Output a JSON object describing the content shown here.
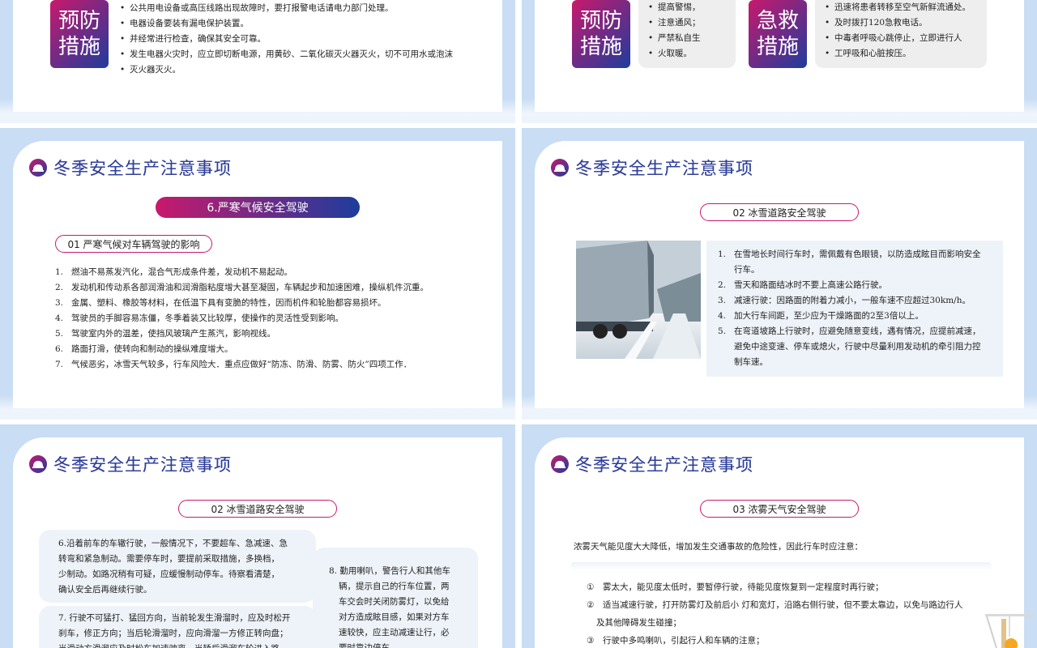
{
  "header_title": "冬季安全生产注意事项",
  "slide_tl": {
    "tag_line1": "预防",
    "tag_line2": "措施",
    "items": [
      "公共用电设备或高压线路出现故障时，要打报警电话请电力部门处理。",
      "电器设备要装有漏电保护装置。",
      "并经常进行检查，确保其安全可靠。",
      "发生电器火灾时，应立即切断电源，用黄砂、二氧化碳灭火器灭火，切不可用水或泡沫",
      "灭火器灭火。"
    ]
  },
  "slide_tr": {
    "tag1_line1": "预防",
    "tag1_line2": "措施",
    "box1": [
      "提高警惕，",
      "注意通风；",
      "严禁私自生",
      "火取暖。"
    ],
    "tag2_line1": "急救",
    "tag2_line2": "措施",
    "box2": [
      "迅速将患者转移至空气新鲜流通处。",
      "及时拨打120急救电话。",
      "中毒者呼吸心跳停止，立即进行人",
      "工呼吸和心脏按压。"
    ]
  },
  "slide_ml": {
    "section_pill": "6.严寒气候安全驾驶",
    "sub_pill": "01 严寒气候对车辆驾驶的影响",
    "items": [
      {
        "n": "1.",
        "t": "燃油不易蒸发汽化，混合气形成条件差，发动机不易起动。"
      },
      {
        "n": "2.",
        "t": "发动机和传动系各部润滑油和润滑脂粘度增大甚至凝固，车辆起步和加速困难，操纵机件沉重。"
      },
      {
        "n": "3.",
        "t": "金属、塑料、橡胶等材料，在低温下具有变脆的特性，因而机件和轮胎都容易损坏。"
      },
      {
        "n": "4.",
        "t": "驾驶员的手脚容易冻僵，冬季着装又比较厚，使操作的灵活性受到影响。"
      },
      {
        "n": "5.",
        "t": "驾驶室内外的温差，使挡风玻璃产生蒸汽，影响视线。"
      },
      {
        "n": "6.",
        "t": "路面打滑，使转向和制动的操纵难度增大。"
      },
      {
        "n": "7.",
        "t": "气候恶劣，冰雪天气较多，行车风险大．重点应做好“防冻、防滑、防雾、防火”四项工作．"
      }
    ]
  },
  "slide_mr": {
    "sub_pill": "02 冰雪道路安全驾驶",
    "items": [
      {
        "n": "1.",
        "t": "在雪地长时间行车时，需佩戴有色眼镜，以防造成眩目而影响安全"
      },
      {
        "n": "",
        "t": "行车。"
      },
      {
        "n": "2.",
        "t": "雪天和路面结冰时不要上高速公路行驶。"
      },
      {
        "n": "3.",
        "t": "减速行驶：因路面的附着力减小，一般车速不应超过30km/h。"
      },
      {
        "n": "4.",
        "t": "加大行车间距，至少应为干燥路面的2至3倍以上。"
      },
      {
        "n": "5.",
        "t": "在弯道坡路上行驶时，应避免随意变线，遇有情况，应提前减速，"
      },
      {
        "n": "",
        "t": "避免中途变速、停车或熄火，行驶中尽量利用发动机的牵引阻力控"
      },
      {
        "n": "",
        "t": "制车速。"
      }
    ]
  },
  "slide_bl": {
    "sub_pill": "02 冰雪道路安全驾驶",
    "box1": [
      "6.沿着前车的车辙行驶，一般情况下，不要超车、急减速、急",
      "转弯和紧急制动。需要停车时，要提前采取措施，多换档，",
      "少制动。如路况稍有可疑，应缓慢制动停车。待察看清楚，",
      "确认安全后再继续行驶。"
    ],
    "box2": [
      "7. 行驶不可猛打、猛回方向，当前轮发生滑溜时，应及时松开",
      "刹车，修正方向；当后轮滑溜时，应向滑溜一方修正转向盘；",
      "当滑动方滑溜应及时松车加速驶离，当轿后滑溜车轮进入路"
    ],
    "box3": [
      "8. 勤用喇叭，警告行人和其他车",
      "辆，提示自己的行车位置，两",
      "车交会时关闭防雾灯，以免给",
      "对方造成眩目感，如果对方车",
      "速较快，应主动减速让行，必",
      "要时靠边停车。"
    ]
  },
  "slide_br": {
    "sub_pill": "03 浓雾天气安全驾驶",
    "intro": "浓雾天气能见度大大降低，增加发生交通事故的危险性，因此行车时应注意：",
    "items": [
      {
        "n": "①",
        "t": "雾太大，能见度太低时，要暂停行驶，待能见度恢复到一定程度时再行驶；"
      },
      {
        "n": "②",
        "t": "适当减速行驶，打开防雾灯及前后小 灯和宽灯，沿路右侧行驶，但不要太靠边，以免与路边行人"
      },
      {
        "n": "",
        "t": "及其他障碍发生碰撞；"
      },
      {
        "n": "③",
        "t": "行驶中多鸣喇叭，引起行人和车辆的注意；"
      }
    ]
  }
}
